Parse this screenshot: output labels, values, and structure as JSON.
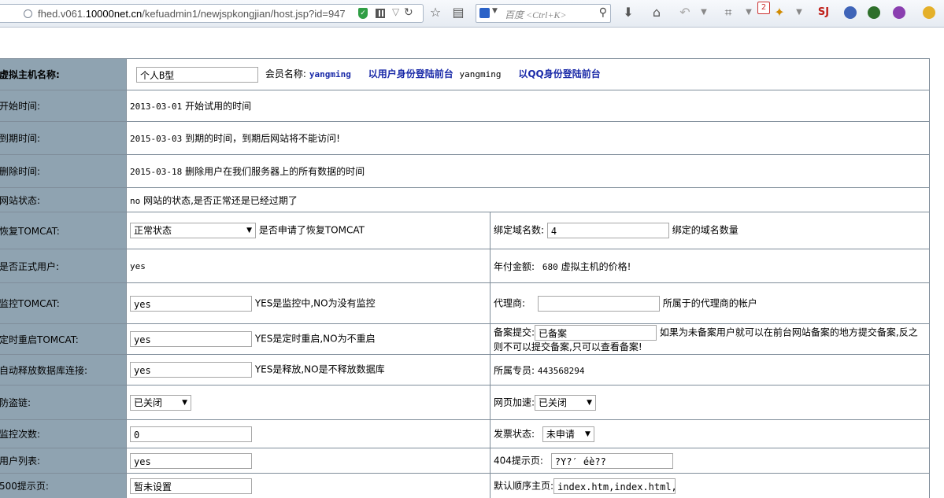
{
  "browser": {
    "url_prefix": "fhed.v061.",
    "url_domain": "10000net.cn",
    "url_path": "/kefuadmin1/newjspkongjian/host.jsp?id=947",
    "search_placeholder": "百度 <Ctrl+K>",
    "badge_count": "2"
  },
  "form": {
    "host_name_label": "虚拟主机名称:",
    "host_name_value": "个人B型",
    "member_label": "会员名称:",
    "member_name": "yangming",
    "login_front_link": "以用户身份登陆前台",
    "login_front_user": "yangming",
    "login_qq_link": "以QQ身份登陆前台",
    "start_label": "开始时间:",
    "start_date": "2013-03-01",
    "start_desc": "开始试用的时间",
    "expire_label": "到期时间:",
    "expire_date": "2015-03-03",
    "expire_desc": "到期的时间，到期后网站将不能访问!",
    "delete_label": "删除时间:",
    "delete_date": "2015-03-18",
    "delete_desc": "删除用户在我们服务器上的所有数据的时间",
    "status_label": "网站状态:",
    "status_value": "no",
    "status_desc": "网站的状态,是否正常还是已经过期了",
    "restore_label": "恢复TOMCAT:",
    "restore_value": "正常状态",
    "restore_desc": "是否申请了恢复TOMCAT",
    "domains_label": "绑定域名数:",
    "domains_value": "4",
    "domains_desc": "绑定的域名数量",
    "formal_label": "是否正式用户:",
    "formal_value": "yes",
    "annual_label": "年付金额:",
    "annual_value": "680",
    "annual_desc": "虚拟主机的价格!",
    "monitor_label": "监控TOMCAT:",
    "monitor_value": "yes",
    "monitor_desc": "YES是监控中,NO为没有监控",
    "agent_label": "代理商:",
    "agent_value": "",
    "agent_desc": "所属于的代理商的帐户",
    "restart_label": "定时重启TOMCAT:",
    "restart_value": "yes",
    "restart_desc": "YES是定时重启,NO为不重启",
    "icp_label": "备案提交:",
    "icp_value": "已备案",
    "icp_desc_1": "如果为未备案用户就可以在前台网站备案的地方提交备案,反之",
    "icp_desc_2": "则不可以提交备案,只可以查看备案!",
    "release_label": "自动释放数据库连接:",
    "release_value": "yes",
    "release_desc": "YES是释放,NO是不释放数据库",
    "staff_label": "所属专员:",
    "staff_value": "443568294",
    "hotlink_label": "防盗链:",
    "hotlink_value": "已关闭",
    "accel_label": "网页加速:",
    "accel_value": "已关闭",
    "monitor_count_label": "监控次数:",
    "monitor_count_value": "0",
    "invoice_label": "发票状态:",
    "invoice_value": "未申请",
    "user_list_label": "用户列表:",
    "user_list_value": "yes",
    "p404_label": "404提示页:",
    "p404_value": "?Y?′ éè??",
    "p500_label": "500提示页:",
    "p500_value": "暂未设置",
    "default_label": "默认顺序主页:",
    "default_value": "index.htm,index.html,i"
  }
}
